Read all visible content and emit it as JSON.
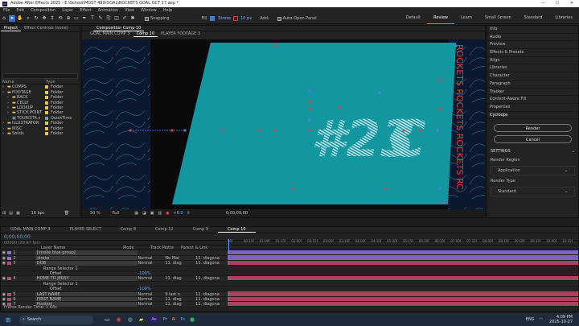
{
  "app": {
    "title": "Adobe After Effects 2025 - E:\\School\\MDST 489\\GOAL\\ROCKETS GOAL OCT 17.aep *",
    "minimize": "—",
    "maximize": "☐",
    "close": "✕"
  },
  "menu": [
    "File",
    "Edit",
    "Composition",
    "Layer",
    "Effect",
    "Animation",
    "View",
    "Window",
    "Help"
  ],
  "toolbar": {
    "snapping": "Snapping",
    "fill": "Fill",
    "stroke": "Stroke",
    "stroke_px": "10 px",
    "add": "Add:",
    "auto_open": "Auto-Open Panel"
  },
  "workspaces": [
    {
      "label": "Default",
      "on": false
    },
    {
      "label": "Review",
      "on": true
    },
    {
      "label": "Learn",
      "on": false
    },
    {
      "label": "Small Screen",
      "on": false
    },
    {
      "label": "Standard",
      "on": false
    },
    {
      "label": "Libraries",
      "on": false
    }
  ],
  "project": {
    "tabs": [
      "Project",
      "Effect Controls (none)"
    ],
    "search": "",
    "headers": [
      "Name",
      "Type"
    ],
    "items": [
      {
        "name": "COMPS",
        "type": "Folder"
      },
      {
        "name": "FOOTAGE",
        "type": "Folder"
      },
      {
        "name": "BACK",
        "type": "Folder"
      },
      {
        "name": "CELLY",
        "type": "Folder"
      },
      {
        "name": "LOOKUP",
        "type": "Folder"
      },
      {
        "name": "STICK POINT",
        "type": "Folder"
      },
      {
        "name": "TOURISTA.v",
        "type": "QuickTime"
      },
      {
        "name": "ILLUSTRATOR",
        "type": "Folder"
      },
      {
        "name": "MISC",
        "type": "Folder"
      },
      {
        "name": "Solids",
        "type": "Folder"
      }
    ],
    "bpc": "16 bpc"
  },
  "viewer": {
    "panel_title": "Composition Comp 10",
    "tabs": [
      {
        "label": "GOAL MAIN COMP 3",
        "on": false
      },
      {
        "label": "Comp 10",
        "on": true
      },
      {
        "label": "PLAYER FOOTAGE 3",
        "on": false
      }
    ],
    "big_text": "#23",
    "big_letter": "C",
    "side_text": "ROCKETS ROCKETS ROCKETS RC",
    "zoom": "50 %",
    "quality": "Full",
    "plus": "+0.0",
    "timecode": "0;00;00;00"
  },
  "right_panel": {
    "items": [
      "Info",
      "Audio",
      "Preview",
      "Effects & Presets",
      "Align",
      "Libraries",
      "Character",
      "Paragraph",
      "Tracker",
      "Content-Aware Fill",
      "Properties",
      "Cycloops"
    ],
    "render": "Render",
    "cancel": "Cancel",
    "settings": "SETTINGS",
    "render_region": "Render Region",
    "application": "Application",
    "render_type": "Render Type",
    "standard": "Standard"
  },
  "timeline": {
    "tabs": [
      {
        "label": "GOAL MAIN COMP 3",
        "on": false
      },
      {
        "label": "PLAYER SELECT",
        "on": false
      },
      {
        "label": "Comp 8",
        "on": false
      },
      {
        "label": "Comp 12",
        "on": false
      },
      {
        "label": "Comp 9",
        "on": false
      },
      {
        "label": "Comp 10",
        "on": true
      }
    ],
    "timecode": "0;00;00;00",
    "fps": "00000 (29.97 fps)",
    "col_name": "Layer Name",
    "col_mode": "Mode",
    "col_track": "Track Matte",
    "col_parent": "Parent & Link",
    "ticks": [
      "00f",
      "00:15f",
      "01:00f",
      "01:15f",
      "02:00f",
      "02:15f",
      "03:00f",
      "03:15f",
      "04:00f",
      "04:15f",
      "05:00f",
      "05:15f",
      "06:00f",
      "06:15f",
      "07:00f",
      "07:15f",
      "08:00f",
      "08:15f",
      "09:00f",
      "09:15f",
      "10:00f",
      "10:15f"
    ],
    "layers": [
      {
        "num": "1",
        "name": "[stroke blue group]",
        "mode": "",
        "track": "",
        "parent": "",
        "color": "#8e6fd1",
        "kind": "layer"
      },
      {
        "num": "2",
        "name": "stroke",
        "mode": "Normal",
        "track": "No Mat",
        "parent": "11. diagona",
        "color": "#8e6fd1",
        "kind": "layer"
      },
      {
        "num": "3",
        "name": "DOB",
        "mode": "Normal",
        "track": "11. diag",
        "parent": "11. diagona",
        "color": "#c0486a",
        "kind": "layer"
      },
      {
        "num": "",
        "name": "Range Selector 1",
        "mode": "",
        "track": "",
        "parent": "",
        "color": "",
        "kind": "sub"
      },
      {
        "num": "",
        "name": "Offset",
        "mode": "-100%",
        "track": "",
        "parent": "",
        "color": "",
        "kind": "sub2"
      },
      {
        "num": "4",
        "name": "HOME TO JERSY",
        "mode": "Normal",
        "track": "11. diag",
        "parent": "11. diagona",
        "color": "#c0486a",
        "kind": "layer"
      },
      {
        "num": "",
        "name": "Range Selector 1",
        "mode": "",
        "track": "",
        "parent": "",
        "color": "",
        "kind": "sub"
      },
      {
        "num": "",
        "name": "Offset",
        "mode": "-100%",
        "track": "",
        "parent": "",
        "color": "",
        "kind": "sub2"
      },
      {
        "num": "5",
        "name": "LAST NAME",
        "mode": "Normal",
        "track": "9 last n",
        "parent": "11. diagona",
        "color": "#c0486a",
        "kind": "layer"
      },
      {
        "num": "6",
        "name": "FIRST NAME",
        "mode": "Normal",
        "track": "11. diag",
        "parent": "11. diagona",
        "color": "#c0486a",
        "kind": "layer"
      },
      {
        "num": "7",
        "name": "Position",
        "mode": "Normal",
        "track": "11. diag",
        "parent": "11. diagona",
        "color": "#c0486a",
        "kind": "layer"
      }
    ],
    "footer": "Frame Render Time: 1.64s"
  },
  "taskbar": {
    "search": "Search",
    "lang": "ENG",
    "time": "4:09 PM",
    "date": "2025-10-27"
  }
}
